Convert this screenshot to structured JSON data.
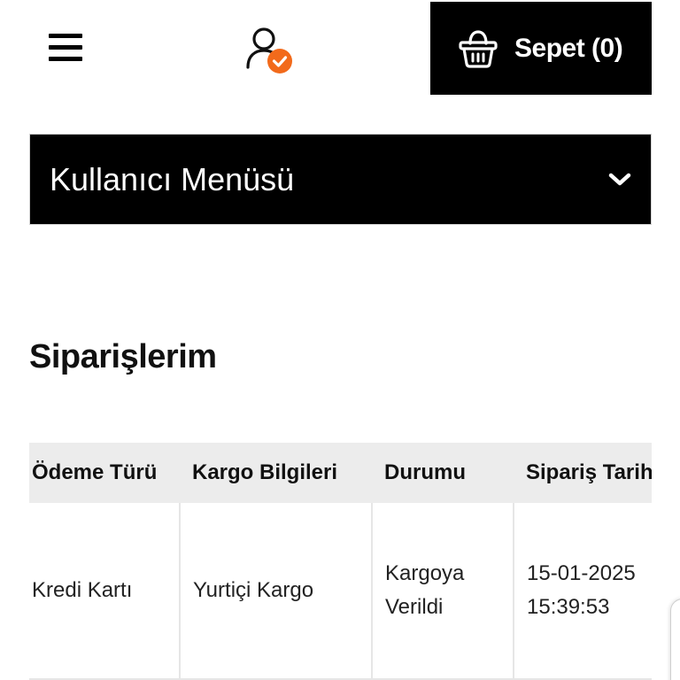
{
  "header": {
    "menu_icon": "hamburger-menu-icon",
    "account_icon": "user-verified-icon",
    "cart": {
      "icon": "shopping-basket-icon",
      "label": "Sepet",
      "count": "(0)"
    }
  },
  "user_menu": {
    "label": "Kullanıcı Menüsü",
    "icon": "chevron-down-icon"
  },
  "page_title": "Siparişlerim",
  "orders": {
    "columns": [
      "Ödeme Türü",
      "Kargo Bilgileri",
      "Durumu",
      "Sipariş Tarih"
    ],
    "rows": [
      {
        "payment": "Kredi Kartı",
        "shipping": "Yurtiçi Kargo",
        "status_line1": "Kargoya",
        "status_line2": "Verildi",
        "date": "15-01-2025",
        "time": "15:39:53"
      }
    ]
  },
  "colors": {
    "accent_orange": "#f26a1b",
    "header_black": "#000000",
    "table_header_bg": "#ececec"
  }
}
